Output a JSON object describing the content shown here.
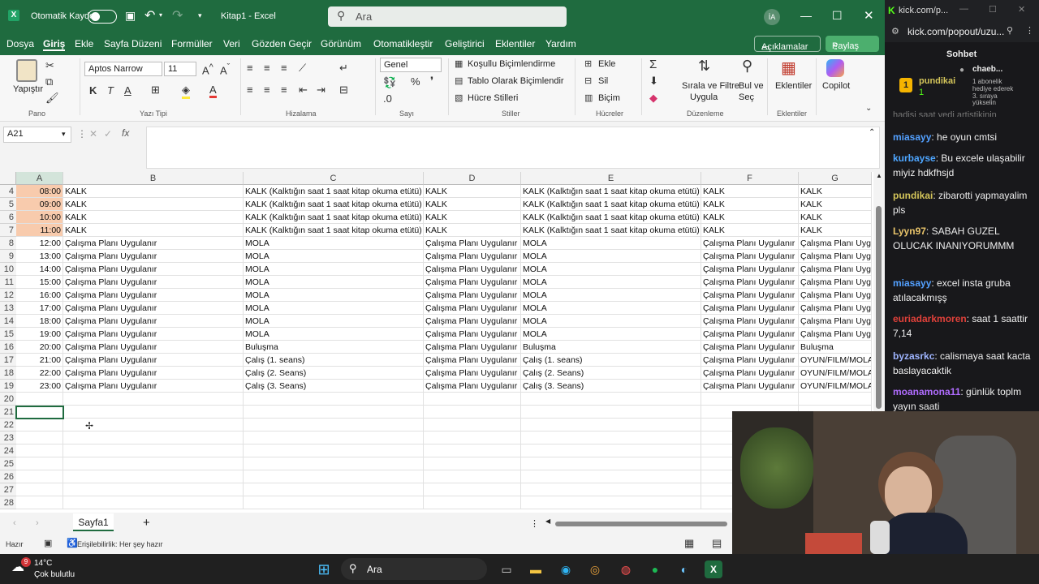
{
  "titlebar": {
    "autosave": "Otomatik Kaydet",
    "title": "Kitap1 - Excel",
    "search_placeholder": "Ara",
    "avatar": "İA"
  },
  "menu": {
    "items": [
      "Dosya",
      "Giriş",
      "Ekle",
      "Sayfa Düzeni",
      "Formüller",
      "Veri",
      "Gözden Geçir",
      "Görünüm",
      "Otomatikleştir",
      "Geliştirici",
      "Eklentiler",
      "Yardım"
    ],
    "comments": "Açıklamalar",
    "share": "Paylaş"
  },
  "ribbon": {
    "paste": "Yapıştır",
    "clipboard": "Pano",
    "font_name": "Aptos Narrow",
    "font_size": "11",
    "font_group": "Yazı Tipi",
    "align_group": "Hizalama",
    "number_format": "Genel",
    "number_group": "Sayı",
    "cond_format": "Koşullu Biçimlendirme",
    "table_format": "Tablo Olarak Biçimlendir",
    "cell_styles": "Hücre Stilleri",
    "styles_group": "Stiller",
    "insert": "Ekle",
    "delete": "Sil",
    "format": "Biçim",
    "cells_group": "Hücreler",
    "sort_filter_1": "Sırala ve Filtre",
    "sort_filter_2": "Uygula",
    "find_1": "Bul ve",
    "find_2": "Seç",
    "editing_group": "Düzenleme",
    "addins": "Eklentiler",
    "addins_group": "Eklentiler",
    "copilot": "Copilot"
  },
  "formula_bar": {
    "name_box": "A21",
    "fx": "fx"
  },
  "columns": [
    "A",
    "B",
    "C",
    "D",
    "E",
    "F",
    "G"
  ],
  "rows": [
    {
      "n": "4",
      "a": "08:00",
      "b": "KALK",
      "c": "KALK (Kalktığın saat 1 saat kitap okuma etütü)",
      "d": "KALK",
      "e": "KALK (Kalktığın saat 1 saat kitap okuma etütü)",
      "f": "KALK",
      "g": "KALK"
    },
    {
      "n": "5",
      "a": "09:00",
      "b": "KALK",
      "c": "KALK (Kalktığın saat 1 saat kitap okuma etütü)",
      "d": "KALK",
      "e": "KALK (Kalktığın saat 1 saat kitap okuma etütü)",
      "f": "KALK",
      "g": "KALK"
    },
    {
      "n": "6",
      "a": "10:00",
      "b": "KALK",
      "c": "KALK (Kalktığın saat 1 saat kitap okuma etütü)",
      "d": "KALK",
      "e": "KALK (Kalktığın saat 1 saat kitap okuma etütü)",
      "f": "KALK",
      "g": "KALK"
    },
    {
      "n": "7",
      "a": "11:00",
      "b": "KALK",
      "c": "KALK (Kalktığın saat 1 saat kitap okuma etütü)",
      "d": "KALK",
      "e": "KALK (Kalktığın saat 1 saat kitap okuma etütü)",
      "f": "KALK",
      "g": "KALK"
    },
    {
      "n": "8",
      "a": "12:00",
      "b": "Çalışma Planı Uygulanır",
      "c": "MOLA",
      "d": "Çalışma Planı Uygulanır",
      "e": "MOLA",
      "f": "Çalışma Planı Uygulanır",
      "g": "Çalışma Planı Uyg"
    },
    {
      "n": "9",
      "a": "13:00",
      "b": "Çalışma Planı Uygulanır",
      "c": "MOLA",
      "d": "Çalışma Planı Uygulanır",
      "e": "MOLA",
      "f": "Çalışma Planı Uygulanır",
      "g": "Çalışma Planı Uyg"
    },
    {
      "n": "10",
      "a": "14:00",
      "b": "Çalışma Planı Uygulanır",
      "c": "MOLA",
      "d": "Çalışma Planı Uygulanır",
      "e": "MOLA",
      "f": "Çalışma Planı Uygulanır",
      "g": "Çalışma Planı Uyg"
    },
    {
      "n": "11",
      "a": "15:00",
      "b": "Çalışma Planı Uygulanır",
      "c": "MOLA",
      "d": "Çalışma Planı Uygulanır",
      "e": "MOLA",
      "f": "Çalışma Planı Uygulanır",
      "g": "Çalışma Planı Uyg"
    },
    {
      "n": "12",
      "a": "16:00",
      "b": "Çalışma Planı Uygulanır",
      "c": "MOLA",
      "d": "Çalışma Planı Uygulanır",
      "e": "MOLA",
      "f": "Çalışma Planı Uygulanır",
      "g": "Çalışma Planı Uyg"
    },
    {
      "n": "13",
      "a": "17:00",
      "b": "Çalışma Planı Uygulanır",
      "c": "MOLA",
      "d": "Çalışma Planı Uygulanır",
      "e": "MOLA",
      "f": "Çalışma Planı Uygulanır",
      "g": "Çalışma Planı Uyg"
    },
    {
      "n": "14",
      "a": "18:00",
      "b": "Çalışma Planı Uygulanır",
      "c": "MOLA",
      "d": "Çalışma Planı Uygulanır",
      "e": "MOLA",
      "f": "Çalışma Planı Uygulanır",
      "g": "Çalışma Planı Uyg"
    },
    {
      "n": "15",
      "a": "19:00",
      "b": "Çalışma Planı Uygulanır",
      "c": "MOLA",
      "d": "Çalışma Planı Uygulanır",
      "e": "MOLA",
      "f": "Çalışma Planı Uygulanır",
      "g": "Çalışma Planı Uyg"
    },
    {
      "n": "16",
      "a": "20:00",
      "b": "Çalışma Planı Uygulanır",
      "c": "Buluşma",
      "d": "Çalışma Planı Uygulanır",
      "e": "Buluşma",
      "f": "Çalışma Planı Uygulanır",
      "g": "Buluşma"
    },
    {
      "n": "17",
      "a": "21:00",
      "b": "Çalışma Planı Uygulanır",
      "c": "Çalış (1. seans)",
      "d": "Çalışma Planı Uygulanır",
      "e": "Çalış (1. seans)",
      "f": "Çalışma Planı Uygulanır",
      "g": "OYUN/FILM/MOLA"
    },
    {
      "n": "18",
      "a": "22:00",
      "b": "Çalışma Planı Uygulanır",
      "c": "Çalış (2. Seans)",
      "d": "Çalışma Planı Uygulanır",
      "e": "Çalış (2. Seans)",
      "f": "Çalışma Planı Uygulanır",
      "g": "OYUN/FILM/MOLA"
    },
    {
      "n": "19",
      "a": "23:00",
      "b": "Çalışma Planı Uygulanır",
      "c": "Çalış (3. Seans)",
      "d": "Çalışma Planı Uygulanır",
      "e": "Çalış (3. Seans)",
      "f": "Çalışma Planı Uygulanır",
      "g": "OYUN/FILM/MOLA"
    },
    {
      "n": "20",
      "a": "",
      "b": "",
      "c": "",
      "d": "",
      "e": "",
      "f": "",
      "g": ""
    },
    {
      "n": "21",
      "a": "",
      "b": "",
      "c": "",
      "d": "",
      "e": "",
      "f": "",
      "g": ""
    },
    {
      "n": "22",
      "a": "",
      "b": "",
      "c": "",
      "d": "",
      "e": "",
      "f": "",
      "g": ""
    },
    {
      "n": "23",
      "a": "",
      "b": "",
      "c": "",
      "d": "",
      "e": "",
      "f": "",
      "g": ""
    },
    {
      "n": "24",
      "a": "",
      "b": "",
      "c": "",
      "d": "",
      "e": "",
      "f": "",
      "g": ""
    },
    {
      "n": "25",
      "a": "",
      "b": "",
      "c": "",
      "d": "",
      "e": "",
      "f": "",
      "g": ""
    },
    {
      "n": "26",
      "a": "",
      "b": "",
      "c": "",
      "d": "",
      "e": "",
      "f": "",
      "g": ""
    },
    {
      "n": "27",
      "a": "",
      "b": "",
      "c": "",
      "d": "",
      "e": "",
      "f": "",
      "g": ""
    },
    {
      "n": "28",
      "a": "",
      "b": "",
      "c": "",
      "d": "",
      "e": "",
      "f": "",
      "g": ""
    }
  ],
  "sheet": {
    "tab": "Sayfa1",
    "add": "+"
  },
  "status": {
    "ready": "Hazır",
    "accessibility": "Erişilebilirlik: Her şey hazır"
  },
  "browser": {
    "tab_title": "kick.com/p...",
    "url": "kick.com/popout/uzu..."
  },
  "chat": {
    "title": "Sohbet",
    "pinned": {
      "rank": "1",
      "name": "pundikai",
      "count": "1",
      "gifter": "chaeb...",
      "gift_line1": "1 abonelik",
      "gift_line2": "hediye ederek",
      "gift_line3": "3. sıraya",
      "gift_line4": "yükselin"
    },
    "cut_top": "hadisi saat yedi artistikinin",
    "messages": [
      {
        "user": "miasayy",
        "text": ": he oyun cmtsi",
        "color": "#53a0ff"
      },
      {
        "user": "kurbayse",
        "text": ": Bu excele ulaşabilir miyiz hdkfhsjd",
        "color": "#4ea6ff"
      },
      {
        "user": "pundikai",
        "text": ": zibarotti yapmayalim pls",
        "color": "#d4c55a"
      },
      {
        "user": "Lyyn97",
        "text": ": SABAH GUZEL OLUCAK INANIYORUMMM",
        "color": "#e9c46a"
      },
      {
        "user": "miasayy",
        "text": ": excel insta gruba atılacakmışş",
        "color": "#53a0ff"
      },
      {
        "user": "euriadarkmoren",
        "text": ": saat 1 saattir 7,14",
        "color": "#e0413a"
      },
      {
        "user": "byzasrkc",
        "text": ": calismaya saat kacta baslayacaktik",
        "color": "#9fb5ff"
      },
      {
        "user": "moanamona11",
        "text": ": günlük toplm yayın saati",
        "color": "#b06cff"
      }
    ]
  },
  "taskbar": {
    "temp": "14°C",
    "weather": "Çok bulutlu",
    "search": "Ara",
    "badge": "9"
  },
  "colors": {
    "excel_green": "#1f6b3f",
    "orange_fill": "#f8cbad",
    "chat_bg": "#18181b"
  }
}
